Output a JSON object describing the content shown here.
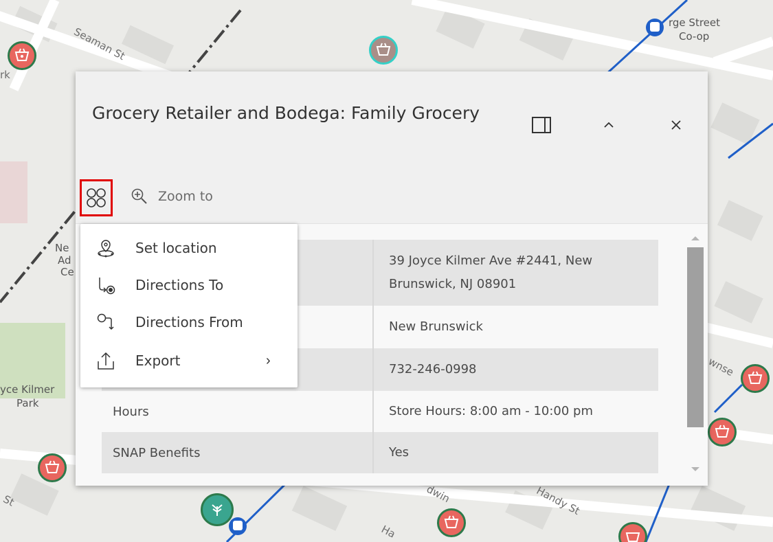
{
  "map": {
    "labels": {
      "seaman": "Seaman St",
      "park_left": "rk",
      "george_street": "rge Street",
      "coop": "Co-op",
      "ne": "Ne",
      "ad": "Ad",
      "ce": "Ce",
      "joyce_kilmer": "yce Kilmer",
      "park": "Park",
      "handy": "Handy St",
      "st_bottom": "St",
      "townsend": "wnse",
      "bottom_a": "dwin",
      "bottom_b": "Ha"
    },
    "colors": {
      "road_blue": "#1f5fc8",
      "marker_fill": "#e8665f",
      "marker_ring": "#2d7a4b",
      "park_green": "#c9dfb8"
    }
  },
  "popup": {
    "title": "Grocery Retailer and Bodega: Family Grocery",
    "dock_icon": "dock-icon",
    "collapse_icon": "chevron-up-icon",
    "close_icon": "close-icon",
    "actions_icon": "actions-grid-icon",
    "zoom_label": "Zoom to",
    "rows": [
      {
        "key": "",
        "value": "39 Joyce Kilmer Ave #2441, New Brunswick, NJ 08901"
      },
      {
        "key": "",
        "value": "New Brunswick"
      },
      {
        "key": "",
        "value": "732-246-0998"
      },
      {
        "key": "Hours",
        "value": "Store Hours: 8:00 am - 10:00 pm"
      },
      {
        "key": "SNAP Benefits",
        "value": "Yes"
      }
    ]
  },
  "menu": {
    "items": [
      {
        "label": "Set location",
        "icon": "set-location-icon"
      },
      {
        "label": "Directions To",
        "icon": "directions-to-icon"
      },
      {
        "label": "Directions From",
        "icon": "directions-from-icon"
      },
      {
        "label": "Export",
        "icon": "export-icon",
        "chevron": "›"
      }
    ]
  }
}
